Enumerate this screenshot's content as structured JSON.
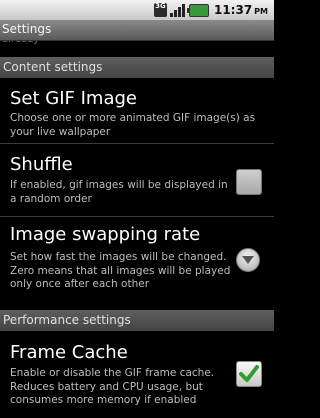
{
  "status_bar": {
    "network": "3G",
    "time": "11:37",
    "ampm": "PM"
  },
  "title_bar": {
    "title": "Settings"
  },
  "cutoff_text": "already",
  "categories": {
    "content": "Content settings",
    "performance": "Performance settings"
  },
  "prefs": {
    "set_gif": {
      "title": "Set GIF Image",
      "summary": "Choose one or more animated GIF image(s) as your live wallpaper"
    },
    "shuffle": {
      "title": "Shuffle",
      "summary": "If enabled, gif images will be displayed in a random order",
      "checked": false,
      "enabled": false
    },
    "swap_rate": {
      "title": "Image swapping rate",
      "summary": "Set how fast the images will be changed. Zero means that all images will be played only once after each other"
    },
    "frame_cache": {
      "title": "Frame Cache",
      "summary": "Enable or disable the GIF frame cache. Reduces battery and CPU usage, but consumes more memory if enabled",
      "checked": true,
      "enabled": true
    }
  },
  "colors": {
    "check_green": "#2e9e2e",
    "category_bg": "#4f4f4f",
    "summary_text": "#bdbdbd"
  }
}
